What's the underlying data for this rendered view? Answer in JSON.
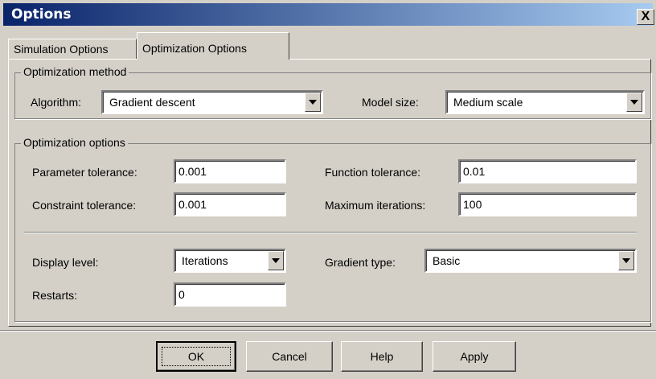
{
  "window": {
    "title": "Options",
    "close_label": "X"
  },
  "tabs": [
    {
      "label": "Simulation Options",
      "selected": false
    },
    {
      "label": "Optimization Options",
      "selected": true
    }
  ],
  "method_group": {
    "legend": "Optimization method",
    "algorithm_label": "Algorithm:",
    "algorithm_value": "Gradient descent",
    "model_size_label": "Model size:",
    "model_size_value": "Medium scale"
  },
  "options_group": {
    "legend": "Optimization options",
    "parameter_tolerance_label": "Parameter tolerance:",
    "parameter_tolerance_value": "0.001",
    "function_tolerance_label": "Function tolerance:",
    "function_tolerance_value": "0.01",
    "constraint_tolerance_label": "Constraint tolerance:",
    "constraint_tolerance_value": "0.001",
    "maximum_iterations_label": "Maximum iterations:",
    "maximum_iterations_value": "100",
    "display_level_label": "Display level:",
    "display_level_value": "Iterations",
    "gradient_type_label": "Gradient type:",
    "gradient_type_value": "Basic",
    "restarts_label": "Restarts:",
    "restarts_value": "0"
  },
  "buttons": {
    "ok": "OK",
    "cancel": "Cancel",
    "help": "Help",
    "apply": "Apply"
  },
  "colors": {
    "title_start": "#0a246a",
    "title_end": "#a6caf0",
    "face": "#d4d0c8"
  }
}
